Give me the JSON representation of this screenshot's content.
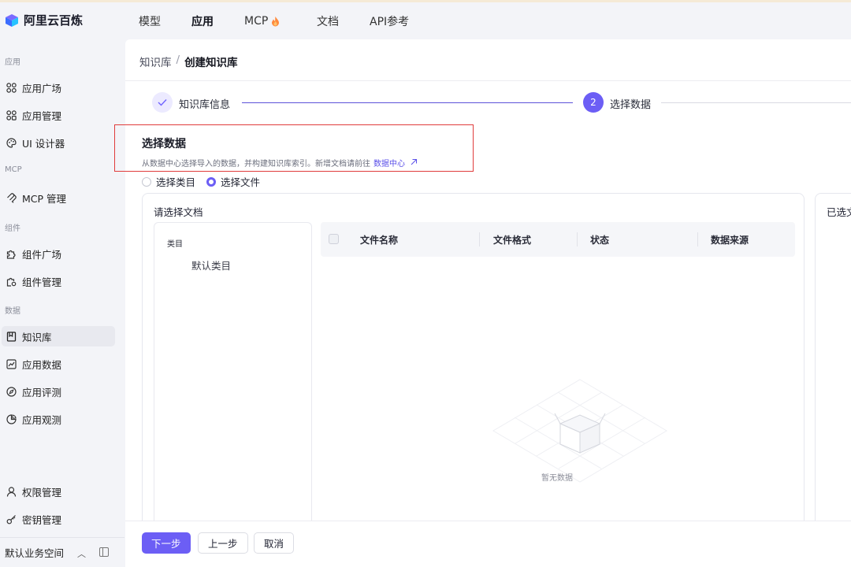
{
  "app": {
    "title": "阿里云百炼"
  },
  "topnav": {
    "items": [
      {
        "label": "模型"
      },
      {
        "label": "应用"
      },
      {
        "label": "MCP"
      },
      {
        "label": "文档"
      },
      {
        "label": "API参考"
      }
    ],
    "active": "应用"
  },
  "sidebar": {
    "groups": {
      "app": "应用",
      "mcp": "MCP",
      "component": "组件",
      "data": "数据"
    },
    "items": [
      {
        "label": "应用广场",
        "icon": "grid-icon"
      },
      {
        "label": "应用管理",
        "icon": "apps-icon"
      },
      {
        "label": "UI 设计器",
        "icon": "palette-icon"
      },
      {
        "label": "MCP 管理",
        "icon": "mcp-icon"
      },
      {
        "label": "组件广场",
        "icon": "puzzle-icon"
      },
      {
        "label": "组件管理",
        "icon": "puzzle-manage-icon"
      },
      {
        "label": "知识库",
        "icon": "book-icon"
      },
      {
        "label": "应用数据",
        "icon": "chart-icon"
      },
      {
        "label": "应用评测",
        "icon": "compass-icon"
      },
      {
        "label": "应用观测",
        "icon": "pie-icon"
      },
      {
        "label": "权限管理",
        "icon": "user-icon"
      },
      {
        "label": "密钥管理",
        "icon": "key-icon"
      }
    ],
    "active": "知识库",
    "workspace": "默认业务空间"
  },
  "breadcrumb": {
    "parent": "知识库",
    "separator": "/",
    "current": "创建知识库"
  },
  "steps": {
    "step1": {
      "label": "知识库信息",
      "state": "done"
    },
    "step2": {
      "number": "2",
      "label": "选择数据",
      "state": "current"
    }
  },
  "section": {
    "title": "选择数据",
    "description": "从数据中心选择导入的数据，并构建知识库索引。新增文档请前往",
    "link": "数据中心",
    "link_icon": "external-link-icon"
  },
  "radios": {
    "category": "选择类目",
    "file": "选择文件",
    "selected": "选择文件"
  },
  "doc_panel": {
    "title": "请选择文档",
    "category_header": "类目",
    "category_item": "默认类目",
    "columns": [
      "文件名称",
      "文件格式",
      "状态",
      "数据来源"
    ],
    "empty_text": "暂无数据"
  },
  "selected_panel": {
    "title": "已选文"
  },
  "footer": {
    "next": "下一步",
    "prev": "上一步",
    "cancel": "取消"
  },
  "colors": {
    "accent": "#6c5ef5",
    "highlight": "#e03c3c"
  }
}
